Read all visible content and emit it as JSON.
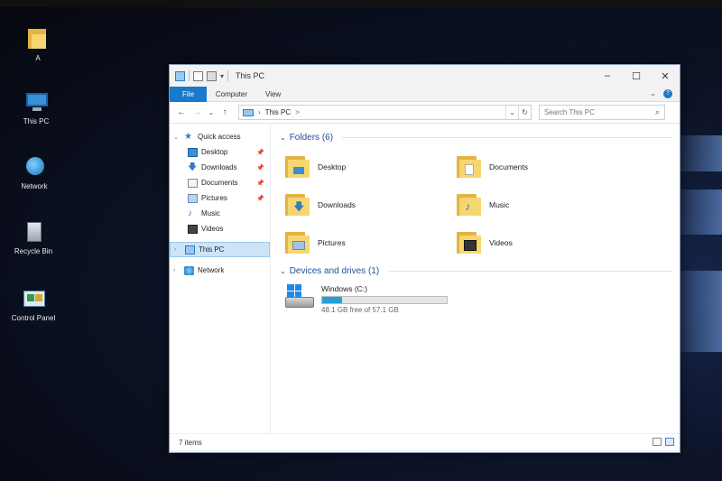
{
  "desktop": {
    "icons": [
      {
        "label": "A"
      },
      {
        "label": "This PC"
      },
      {
        "label": "Network"
      },
      {
        "label": "Recycle Bin"
      },
      {
        "label": "Control Panel"
      }
    ]
  },
  "window": {
    "title": "This PC",
    "controls": {
      "minimize": "–",
      "maximize": "☐",
      "close": "✕"
    },
    "ribbon": {
      "tabs": [
        "File",
        "Computer",
        "View"
      ],
      "expand": "⌄",
      "help": "?"
    },
    "nav": {
      "back": "←",
      "forward": "→",
      "recent": "⌄",
      "up": "↑",
      "address": [
        "This PC",
        ">"
      ],
      "address_dropdown": "⌄",
      "refresh": "↻",
      "search_placeholder": "Search This PC"
    },
    "navpane": {
      "quick_access": "Quick access",
      "quick_items": [
        {
          "label": "Desktop",
          "pinned": true
        },
        {
          "label": "Downloads",
          "pinned": true
        },
        {
          "label": "Documents",
          "pinned": true
        },
        {
          "label": "Pictures",
          "pinned": true
        },
        {
          "label": "Music",
          "pinned": false
        },
        {
          "label": "Videos",
          "pinned": false
        }
      ],
      "this_pc": "This PC",
      "network": "Network"
    },
    "content": {
      "folders_header": "Folders (6)",
      "folders": [
        "Desktop",
        "Documents",
        "Downloads",
        "Music",
        "Pictures",
        "Videos"
      ],
      "drives_header": "Devices and drives (1)",
      "drive": {
        "name": "Windows (C:)",
        "free_text": "48.1 GB free of 57.1 GB",
        "used_fraction": 0.16
      }
    },
    "status": {
      "items": "7 items"
    }
  },
  "colors": {
    "accent": "#1979ca",
    "folder": "#f7d66f",
    "selection": "#cce4f7",
    "drive_bar": "#26a0da"
  }
}
